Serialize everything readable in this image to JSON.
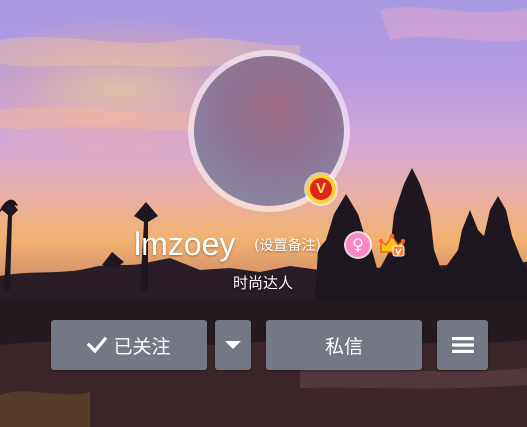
{
  "profile": {
    "name": "lmzoey",
    "remark_link": "(设置备注)",
    "title": "时尚达人"
  },
  "actions": {
    "follow_label": "已关注",
    "message_label": "私信"
  },
  "icons": {
    "verified": "verified-v-badge-icon",
    "gender": "female-icon",
    "vip": "crown-vip-icon",
    "follow_check": "check-icon",
    "dropdown": "caret-down-icon",
    "menu": "hamburger-menu-icon"
  },
  "colors": {
    "button_bg": "#737884",
    "verified_badge": "#ffd23a",
    "gender_badge": "#ff86c4"
  }
}
